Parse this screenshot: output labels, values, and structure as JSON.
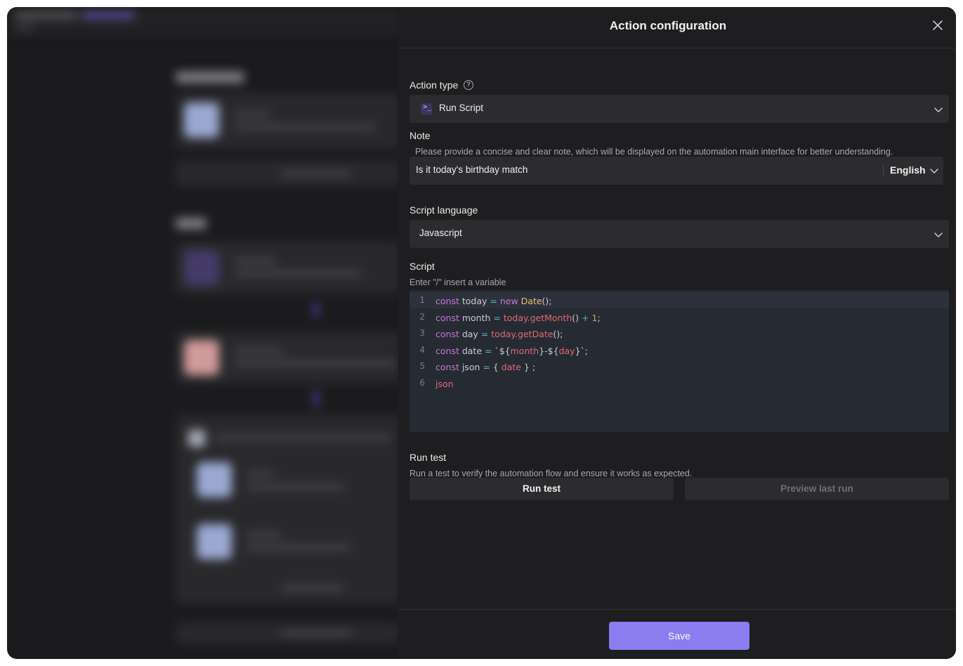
{
  "panel": {
    "title": "Action configuration"
  },
  "action_type": {
    "label": "Action type",
    "value": "Run Script",
    "icon": "terminal-icon"
  },
  "note": {
    "label": "Note",
    "description": "Please provide a concise and clear note, which will be displayed on the automation main interface for better understanding.",
    "value": "Is it today's birthday match",
    "language": "English"
  },
  "script_language": {
    "label": "Script language",
    "value": "Javascript"
  },
  "script": {
    "label": "Script",
    "hint": "Enter \"/\" insert a variable",
    "line_numbers": [
      "1",
      "2",
      "3",
      "4",
      "5",
      "6"
    ],
    "lines": [
      "const today = new Date();",
      "const month = today.getMonth() + 1;",
      "const day = today.getDate();",
      "const date = `${month}-${day}`;",
      "const json = { date } ;",
      "json"
    ]
  },
  "run_test": {
    "label": "Run test",
    "description": "Run a test to verify the automation flow and ensure it works as expected.",
    "run_button": "Run test",
    "preview_button": "Preview last run"
  },
  "footer": {
    "save_button": "Save"
  },
  "colors": {
    "accent": "#8b7cf0",
    "panel_bg": "#1e1e20",
    "editor_bg": "#262a33"
  }
}
